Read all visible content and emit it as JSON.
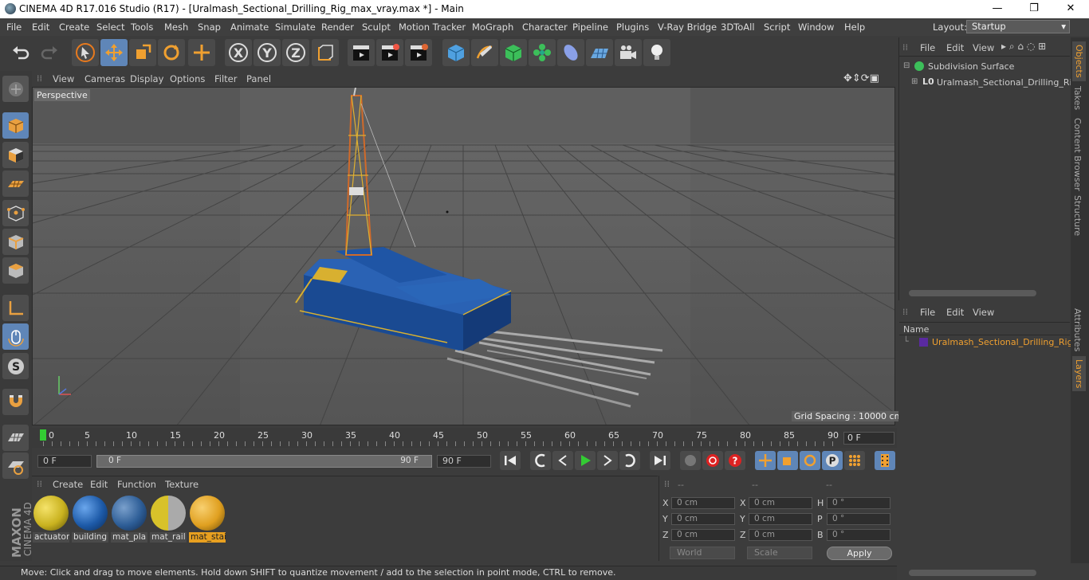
{
  "window": {
    "title": "CINEMA 4D R17.016 Studio (R17) - [Uralmash_Sectional_Drilling_Rig_max_vray.max *] - Main",
    "minimize": "—",
    "maximize": "❐",
    "close": "✕"
  },
  "menubar": [
    "File",
    "Edit",
    "Create",
    "Select",
    "Tools",
    "Mesh",
    "Snap",
    "Animate",
    "Simulate",
    "Render",
    "Sculpt",
    "Motion Tracker",
    "MoGraph",
    "Character",
    "Pipeline",
    "Plugins",
    "V-Ray Bridge",
    "3DToAll",
    "Script",
    "Window",
    "Help"
  ],
  "layout": {
    "label": "Layout:",
    "value": "Startup"
  },
  "viewport": {
    "menu": [
      "View",
      "Cameras",
      "Display",
      "Options",
      "Filter",
      "Panel"
    ],
    "camera": "Perspective",
    "grid_spacing": "Grid Spacing : 10000 cm"
  },
  "timeline": {
    "ticks": [
      "0",
      "5",
      "10",
      "15",
      "20",
      "25",
      "30",
      "35",
      "40",
      "45",
      "50",
      "55",
      "60",
      "65",
      "70",
      "75",
      "80",
      "85",
      "90"
    ],
    "current": "0 F"
  },
  "transport": {
    "start": "0 F",
    "range_left": "0 F",
    "range_right": "90 F",
    "end": "90 F"
  },
  "materials": {
    "menu": [
      "Create",
      "Edit",
      "Function",
      "Texture"
    ],
    "items": [
      {
        "name": "actuator",
        "color": "#c9b21f"
      },
      {
        "name": "building",
        "color": "#1d5aa8"
      },
      {
        "name": "mat_pla",
        "color": "#2d5d96"
      },
      {
        "name": "mat_rail",
        "color": "#d8c22a"
      },
      {
        "name": "mat_stai",
        "color": "#e0a020"
      }
    ]
  },
  "coords": {
    "headers": [
      "--",
      "--",
      "--"
    ],
    "rows": [
      {
        "a": "X",
        "av": "0 cm",
        "b": "X",
        "bv": "0 cm",
        "c": "H",
        "cv": "0 °"
      },
      {
        "a": "Y",
        "av": "0 cm",
        "b": "Y",
        "bv": "0 cm",
        "c": "P",
        "cv": "0 °"
      },
      {
        "a": "Z",
        "av": "0 cm",
        "b": "Z",
        "bv": "0 cm",
        "c": "B",
        "cv": "0 °"
      }
    ],
    "mode": "World",
    "scale": "Scale",
    "apply": "Apply"
  },
  "objects": {
    "menu": [
      "File",
      "Edit",
      "View"
    ],
    "items": [
      "Subdivision Surface",
      "Uralmash_Sectional_Drilling_Rig"
    ]
  },
  "layers": {
    "menu": [
      "File",
      "Edit",
      "View"
    ],
    "header": "Name",
    "items": [
      "Uralmash_Sectional_Drilling_Rig"
    ]
  },
  "right_tabs": [
    "Objects",
    "Takes",
    "Content Browser",
    "Structure",
    "Attributes",
    "Layers"
  ],
  "status": "Move: Click and drag to move elements. Hold down SHIFT to quantize movement / add to the selection in point mode, CTRL to remove.",
  "brand": {
    "line1": "MAXON",
    "line2": "CINEMA 4D"
  }
}
